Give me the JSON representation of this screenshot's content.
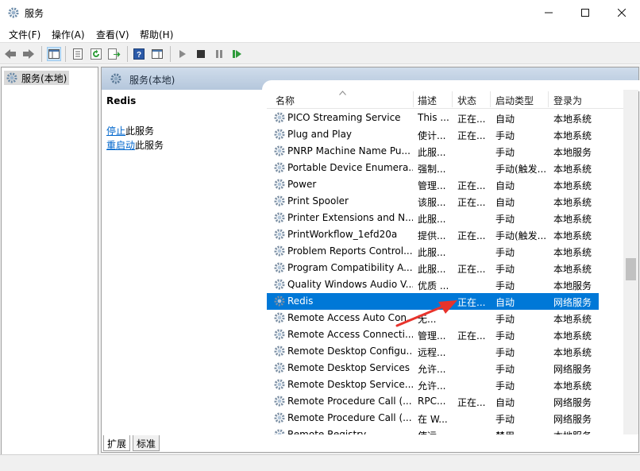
{
  "window": {
    "title": "服务",
    "minimize": "—",
    "maximize": "☐",
    "close": "✕"
  },
  "menu": [
    "文件(F)",
    "操作(A)",
    "查看(V)",
    "帮助(H)"
  ],
  "tree": {
    "root": "服务(本地)"
  },
  "header": {
    "title": "服务(本地)"
  },
  "details": {
    "service_name": "Redis",
    "stop_link": "停止",
    "stop_suffix": "此服务",
    "restart_link": "重启动",
    "restart_suffix": "此服务"
  },
  "columns": [
    "名称",
    "描述",
    "状态",
    "启动类型",
    "登录为"
  ],
  "rows": [
    {
      "name": "PICO Streaming Service",
      "desc": "This ...",
      "status": "正在...",
      "startup": "自动",
      "logon": "本地系统"
    },
    {
      "name": "Plug and Play",
      "desc": "使计...",
      "status": "正在...",
      "startup": "手动",
      "logon": "本地系统"
    },
    {
      "name": "PNRP Machine Name Pu...",
      "desc": "此服...",
      "status": "",
      "startup": "手动",
      "logon": "本地服务"
    },
    {
      "name": "Portable Device Enumera...",
      "desc": "强制...",
      "status": "",
      "startup": "手动(触发...",
      "logon": "本地系统"
    },
    {
      "name": "Power",
      "desc": "管理...",
      "status": "正在...",
      "startup": "自动",
      "logon": "本地系统"
    },
    {
      "name": "Print Spooler",
      "desc": "该服...",
      "status": "正在...",
      "startup": "自动",
      "logon": "本地系统"
    },
    {
      "name": "Printer Extensions and N...",
      "desc": "此服...",
      "status": "",
      "startup": "手动",
      "logon": "本地系统"
    },
    {
      "name": "PrintWorkflow_1efd20a",
      "desc": "提供...",
      "status": "正在...",
      "startup": "手动(触发...",
      "logon": "本地系统"
    },
    {
      "name": "Problem Reports Control...",
      "desc": "此服...",
      "status": "",
      "startup": "手动",
      "logon": "本地系统"
    },
    {
      "name": "Program Compatibility A...",
      "desc": "此服...",
      "status": "正在...",
      "startup": "手动",
      "logon": "本地系统"
    },
    {
      "name": "Quality Windows Audio V...",
      "desc": "优质 ...",
      "status": "",
      "startup": "手动",
      "logon": "本地服务"
    },
    {
      "name": "Redis",
      "desc": "",
      "status": "正在...",
      "startup": "自动",
      "logon": "网络服务",
      "selected": true
    },
    {
      "name": "Remote Access Auto Con...",
      "desc": "无...",
      "status": "",
      "startup": "手动",
      "logon": "本地系统"
    },
    {
      "name": "Remote Access Connecti...",
      "desc": "管理...",
      "status": "正在...",
      "startup": "手动",
      "logon": "本地系统"
    },
    {
      "name": "Remote Desktop Configu...",
      "desc": "远程...",
      "status": "",
      "startup": "手动",
      "logon": "本地系统"
    },
    {
      "name": "Remote Desktop Services",
      "desc": "允许...",
      "status": "",
      "startup": "手动",
      "logon": "网络服务"
    },
    {
      "name": "Remote Desktop Service...",
      "desc": "允许...",
      "status": "",
      "startup": "手动",
      "logon": "本地系统"
    },
    {
      "name": "Remote Procedure Call (...",
      "desc": "RPC...",
      "status": "正在...",
      "startup": "自动",
      "logon": "网络服务"
    },
    {
      "name": "Remote Procedure Call (...",
      "desc": "在 W...",
      "status": "",
      "startup": "手动",
      "logon": "网络服务"
    },
    {
      "name": "Remote Registry",
      "desc": "使远...",
      "status": "",
      "startup": "禁用",
      "logon": "本地服务"
    }
  ],
  "tabs": [
    "扩展",
    "标准"
  ],
  "colors": {
    "selection": "#0078d7",
    "link": "#0066cc",
    "header": "#c2d2e6",
    "annotation_arrow": "#e8332c"
  }
}
